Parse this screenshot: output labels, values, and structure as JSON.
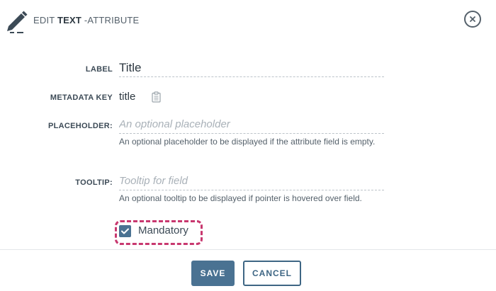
{
  "header": {
    "title_prefix": "EDIT ",
    "title_bold": "TEXT",
    "title_suffix": " -ATTRIBUTE",
    "icon": "pencil-icon",
    "close_icon": "close-icon"
  },
  "form": {
    "label": {
      "label": "LABEL",
      "value": "Title"
    },
    "metadata_key": {
      "label": "METADATA KEY",
      "value": "title",
      "icon": "clipboard-icon"
    },
    "placeholder": {
      "label": "PLACEHOLDER:",
      "value": "",
      "placeholder": "An optional placeholder",
      "help": "An optional placeholder to be displayed if the attribute field is empty."
    },
    "tooltip": {
      "label": "TOOLTIP:",
      "value": "",
      "placeholder": "Tooltip for field",
      "help": "An optional tooltip to be displayed if pointer is hovered over field."
    },
    "mandatory": {
      "label": "Mandatory",
      "checked": true
    }
  },
  "footer": {
    "save_label": "SAVE",
    "cancel_label": "CANCEL"
  },
  "colors": {
    "accent": "#4a7292",
    "highlight": "#c8386f",
    "text": "#3c4a56"
  }
}
